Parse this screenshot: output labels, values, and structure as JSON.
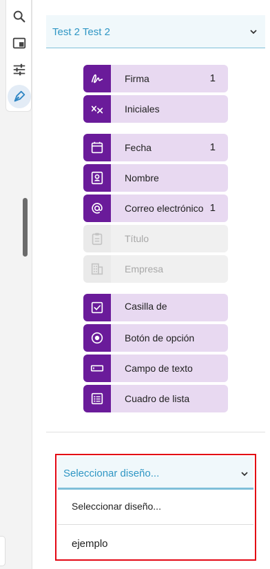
{
  "recipient": {
    "name": "Test 2 Test 2"
  },
  "fields": [
    {
      "label": "Firma",
      "count": "1",
      "icon": "signature-icon",
      "enabled": true
    },
    {
      "label": "Iniciales",
      "count": "",
      "icon": "initials-icon",
      "enabled": true
    },
    {
      "label": "Fecha",
      "count": "1",
      "icon": "calendar-icon",
      "enabled": true
    },
    {
      "label": "Nombre",
      "count": "",
      "icon": "name-badge-icon",
      "enabled": true
    },
    {
      "label": "Correo electrónico",
      "count": "1",
      "icon": "at-sign-icon",
      "enabled": true
    },
    {
      "label": "Título",
      "count": "",
      "icon": "clipboard-icon",
      "enabled": false
    },
    {
      "label": "Empresa",
      "count": "",
      "icon": "building-icon",
      "enabled": false
    },
    {
      "label": "Casilla de verificación",
      "count": "",
      "icon": "checkbox-icon",
      "enabled": true
    },
    {
      "label": "Botón de opción",
      "count": "",
      "icon": "radio-button-icon",
      "enabled": true
    },
    {
      "label": "Campo de texto",
      "count": "",
      "icon": "text-field-icon",
      "enabled": true
    },
    {
      "label": "Cuadro de lista",
      "count": "",
      "icon": "list-box-icon",
      "enabled": true
    }
  ],
  "design_select": {
    "selected": "Seleccionar diseño...",
    "options": [
      "Seleccionar diseño...",
      "ejemplo"
    ]
  },
  "colors": {
    "accent": "#2f96c4",
    "field_icon": "#6a1b9a",
    "field_body": "#e8d9f1",
    "highlight": "#e30613"
  }
}
